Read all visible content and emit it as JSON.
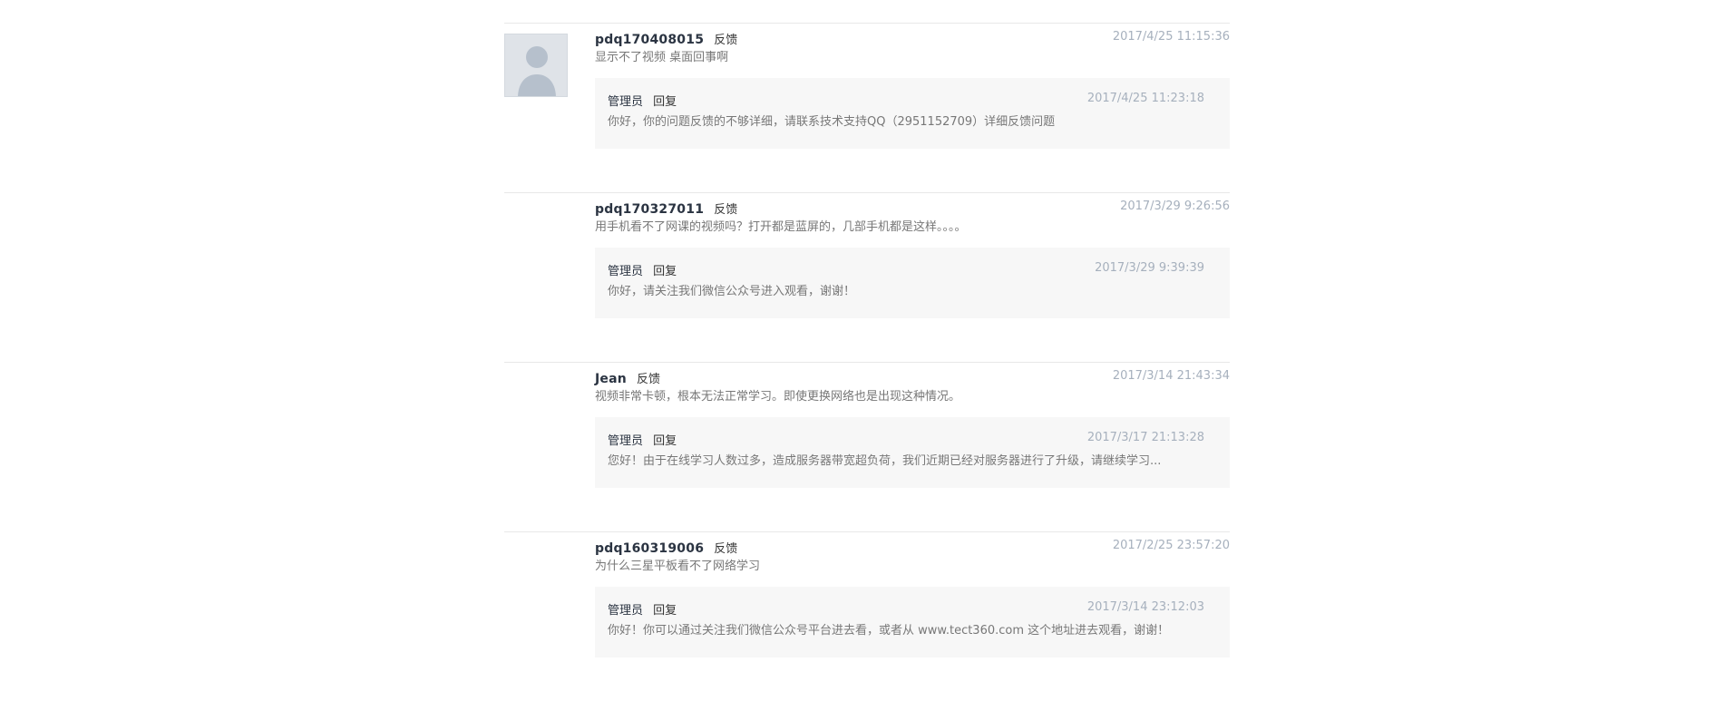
{
  "entries": [
    {
      "username": "pdq170408015",
      "kind_label": "反馈",
      "time": "2017/4/25 11:15:36",
      "message": "显示不了视频  桌面回事啊",
      "show_avatar": true,
      "reply": {
        "author": "管理员",
        "action_label": "回复",
        "time": "2017/4/25 11:23:18",
        "message": "你好，你的问题反馈的不够详细，请联系技术支持QQ（2951152709）详细反馈问题"
      }
    },
    {
      "username": "pdq170327011",
      "kind_label": "反馈",
      "time": "2017/3/29 9:26:56",
      "message": "用手机看不了网课的视频吗？打开都是蓝屏的，几部手机都是这样。。。。",
      "show_avatar": false,
      "reply": {
        "author": "管理员",
        "action_label": "回复",
        "time": "2017/3/29 9:39:39",
        "message": "你好，请关注我们微信公众号进入观看，谢谢！"
      }
    },
    {
      "username": "Jean",
      "kind_label": "反馈",
      "time": "2017/3/14 21:43:34",
      "message": "视频非常卡顿，根本无法正常学习。即使更换网络也是出现这种情况。",
      "show_avatar": false,
      "reply": {
        "author": "管理员",
        "action_label": "回复",
        "time": "2017/3/17 21:13:28",
        "message": "您好！由于在线学习人数过多，造成服务器带宽超负荷，我们近期已经对服务器进行了升级，请继续学习..."
      }
    },
    {
      "username": "pdq160319006",
      "kind_label": "反馈",
      "time": "2017/2/25 23:57:20",
      "message": "为什么三星平板看不了网络学习",
      "show_avatar": false,
      "reply": {
        "author": "管理员",
        "action_label": "回复",
        "time": "2017/3/14 23:12:03",
        "message": "你好！你可以通过关注我们微信公众号平台进去看，或者从 www.tect360.com 这个地址进去观看，谢谢！"
      }
    }
  ]
}
